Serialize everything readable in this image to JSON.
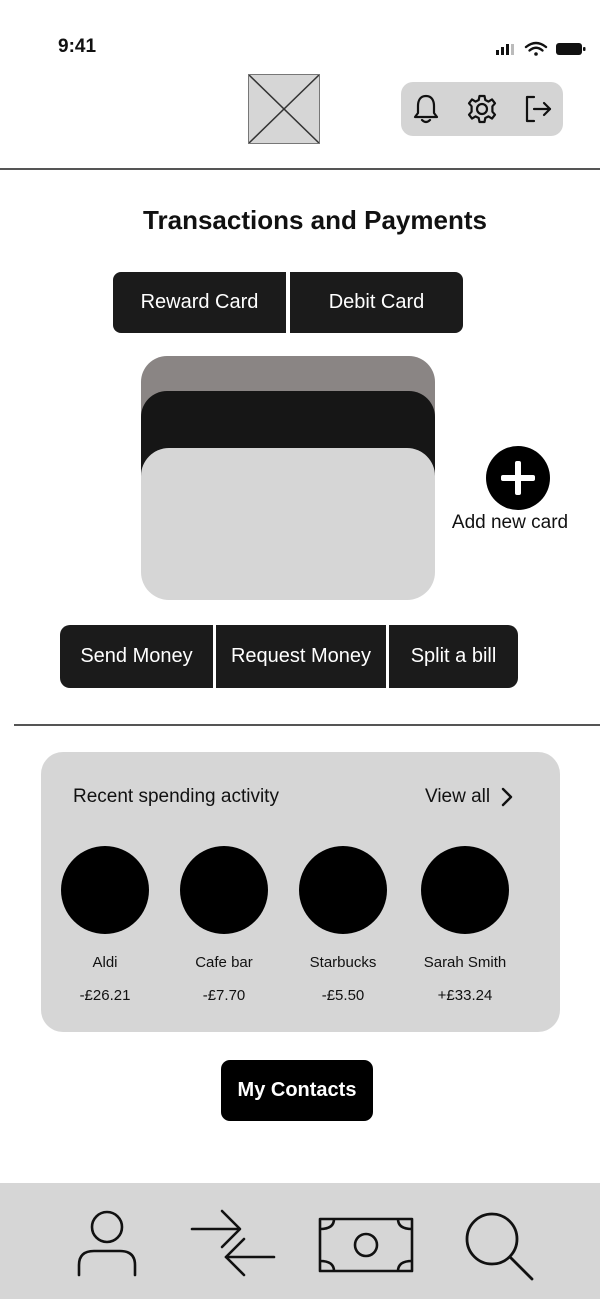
{
  "status_bar": {
    "time": "9:41"
  },
  "header": {
    "actions": [
      {
        "name": "notifications",
        "icon": "bell-icon"
      },
      {
        "name": "settings",
        "icon": "gear-icon"
      },
      {
        "name": "logout",
        "icon": "logout-icon"
      }
    ]
  },
  "page_title": "Transactions and Payments",
  "card_tabs": [
    "Reward Card",
    "Debit Card"
  ],
  "add_card_label": "Add new card",
  "actions": [
    "Send Money",
    "Request Money",
    "Split a bill"
  ],
  "recent_activity": {
    "title": "Recent spending activity",
    "view_all": "View all",
    "merchants": [
      {
        "name": "Aldi",
        "amount": "-£26.21"
      },
      {
        "name": "Cafe bar",
        "amount": "-£7.70"
      },
      {
        "name": "Starbucks",
        "amount": "-£5.50"
      },
      {
        "name": "Sarah Smith",
        "amount": "+£33.24"
      }
    ]
  },
  "contacts_button": "My Contacts",
  "bottom_nav": [
    {
      "name": "profile",
      "icon": "user-icon"
    },
    {
      "name": "transfers",
      "icon": "transfer-arrows-icon"
    },
    {
      "name": "payments",
      "icon": "cash-icon"
    },
    {
      "name": "search",
      "icon": "search-icon"
    }
  ]
}
